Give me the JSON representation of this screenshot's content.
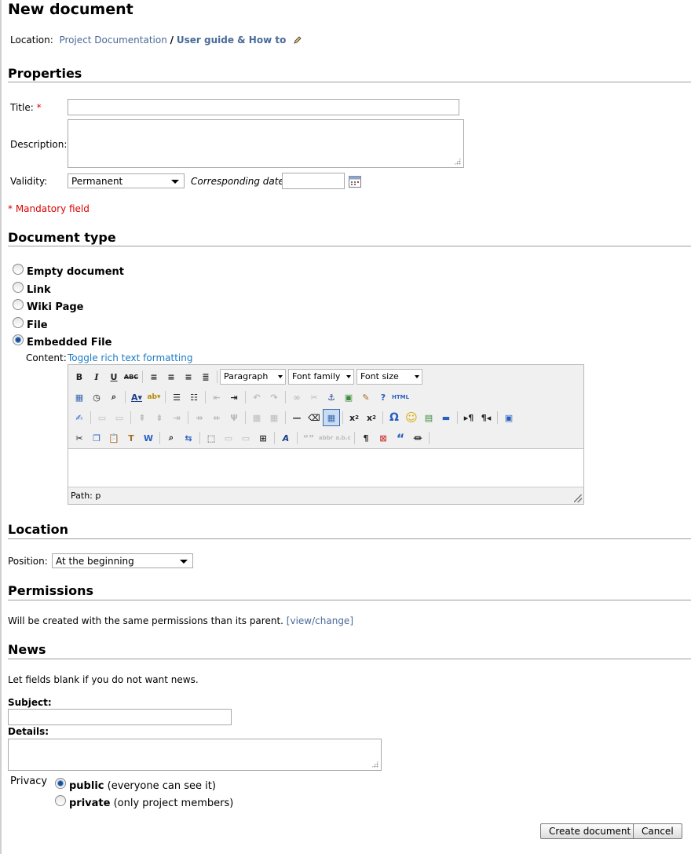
{
  "page": {
    "title": "New document"
  },
  "location_bar": {
    "label": "Location:",
    "parent": "Project Documentation",
    "separator": "/",
    "current": "User guide & How to"
  },
  "properties": {
    "heading": "Properties",
    "title_label": "Title:",
    "required_mark": "*",
    "description_label": "Description:",
    "validity_label": "Validity:",
    "validity_value": "Permanent",
    "date_label": "Corresponding date:",
    "mandatory_note": "* Mandatory field"
  },
  "doc_type": {
    "heading": "Document type",
    "options": [
      {
        "label": "Empty document",
        "selected": false
      },
      {
        "label": "Link",
        "selected": false
      },
      {
        "label": "Wiki Page",
        "selected": false
      },
      {
        "label": "File",
        "selected": false
      },
      {
        "label": "Embedded File",
        "selected": true
      }
    ],
    "content_label": "Content:",
    "toggle_link": "Toggle rich text formatting"
  },
  "editor": {
    "format_select": "Paragraph",
    "font_family_select": "Font family",
    "font_size_select": "Font size",
    "path_text": "Path: p",
    "icons": [
      "bold-icon",
      "italic-icon",
      "underline-icon",
      "strikethrough-icon",
      "align-left-icon",
      "align-center-icon",
      "align-right-icon",
      "justify-icon",
      "insert-date-icon",
      "insert-time-icon",
      "preview-icon",
      "text-color-icon",
      "highlight-color-icon",
      "bullet-list-icon",
      "numbered-list-icon",
      "outdent-icon",
      "indent-icon",
      "undo-icon",
      "redo-icon",
      "link-icon",
      "unlink-icon",
      "anchor-icon",
      "image-icon",
      "cleanup-icon",
      "help-icon",
      "html-source-icon",
      "edit-attributes-icon",
      "subscript-icon",
      "superscript-icon",
      "special-char-icon",
      "emoticon-icon",
      "media-icon",
      "hr-icon",
      "ltr-icon",
      "rtl-icon",
      "fullscreen-icon",
      "cut-icon",
      "copy-icon",
      "paste-icon",
      "paste-text-icon",
      "paste-word-icon",
      "find-icon",
      "replace-icon",
      "visual-aid-icon",
      "styles-icon",
      "blockquote-icon",
      "pagebreak-icon",
      "nonbreaking-icon",
      "table-icon"
    ],
    "html_label": "HTML",
    "sub_label": "x",
    "sup_label": "x",
    "omega": "Ω",
    "pilcrow": "¶",
    "quote": "“",
    "text_style_label": "A"
  },
  "location": {
    "heading": "Location",
    "position_label": "Position:",
    "position_value": "At the beginning"
  },
  "permissions": {
    "heading": "Permissions",
    "text": "Will be created with the same permissions than its parent.",
    "link": "[view/change]"
  },
  "news": {
    "heading": "News",
    "hint": "Let fields blank if you do not want news.",
    "subject_label": "Subject:",
    "details_label": "Details:",
    "privacy_label": "Privacy",
    "privacy_options": [
      {
        "label": "public",
        "note": "(everyone can see it)",
        "selected": true
      },
      {
        "label": "private",
        "note": "(only project members)",
        "selected": false
      }
    ]
  },
  "actions": {
    "create_label": "Create document",
    "cancel_label": "Cancel"
  }
}
